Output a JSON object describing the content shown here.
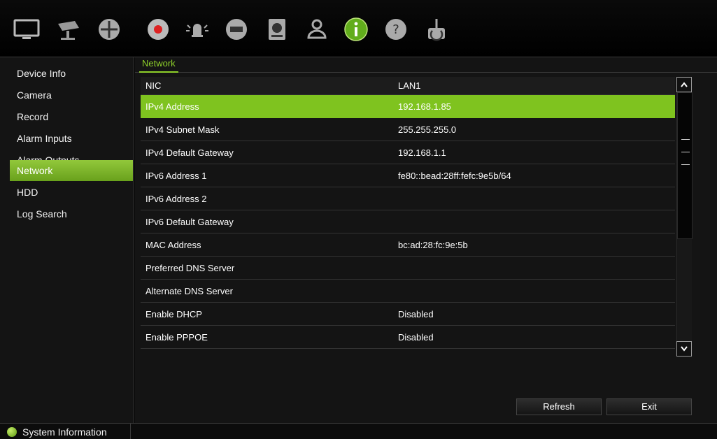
{
  "toolbar": {
    "icons": [
      {
        "name": "live-view-monitor-icon",
        "active": false
      },
      {
        "name": "camera-icon",
        "active": false
      },
      {
        "name": "ptz-dome-icon",
        "active": false
      },
      {
        "name": "record-icon",
        "active": false
      },
      {
        "name": "alarm-icon",
        "active": false
      },
      {
        "name": "network-icon",
        "active": false
      },
      {
        "name": "hdd-icon",
        "active": false
      },
      {
        "name": "user-icon",
        "active": false
      },
      {
        "name": "information-icon",
        "active": true
      },
      {
        "name": "help-icon",
        "active": false
      },
      {
        "name": "power-icon",
        "active": false
      }
    ]
  },
  "sidebar": {
    "items": [
      {
        "label": "Device Info",
        "active": false
      },
      {
        "label": "Camera",
        "active": false
      },
      {
        "label": "Record",
        "active": false
      },
      {
        "label": "Alarm Inputs",
        "active": false
      },
      {
        "label": "Alarm Outputs",
        "active": false
      },
      {
        "label": "Network",
        "active": true
      },
      {
        "label": "HDD",
        "active": false
      },
      {
        "label": "Log Search",
        "active": false
      }
    ]
  },
  "tabs": [
    {
      "label": "Network",
      "active": true
    }
  ],
  "table": {
    "headers": [
      "NIC",
      "LAN1"
    ],
    "rows": [
      {
        "label": "IPv4 Address",
        "value": "192.168.1.85",
        "selected": true
      },
      {
        "label": "IPv4 Subnet Mask",
        "value": "255.255.255.0"
      },
      {
        "label": "IPv4 Default Gateway",
        "value": "192.168.1.1"
      },
      {
        "label": "IPv6 Address 1",
        "value": "fe80::bead:28ff:fefc:9e5b/64"
      },
      {
        "label": "IPv6 Address 2",
        "value": ""
      },
      {
        "label": "IPv6 Default Gateway",
        "value": ""
      },
      {
        "label": "MAC Address",
        "value": "bc:ad:28:fc:9e:5b"
      },
      {
        "label": "Preferred DNS Server",
        "value": ""
      },
      {
        "label": "Alternate DNS Server",
        "value": ""
      },
      {
        "label": "Enable DHCP",
        "value": "Disabled"
      },
      {
        "label": "Enable PPPOE",
        "value": "Disabled"
      }
    ]
  },
  "buttons": {
    "refresh": "Refresh",
    "exit": "Exit"
  },
  "status": {
    "label": "System Information"
  },
  "colors": {
    "accent": "#7fc31f",
    "background": "#141414"
  }
}
